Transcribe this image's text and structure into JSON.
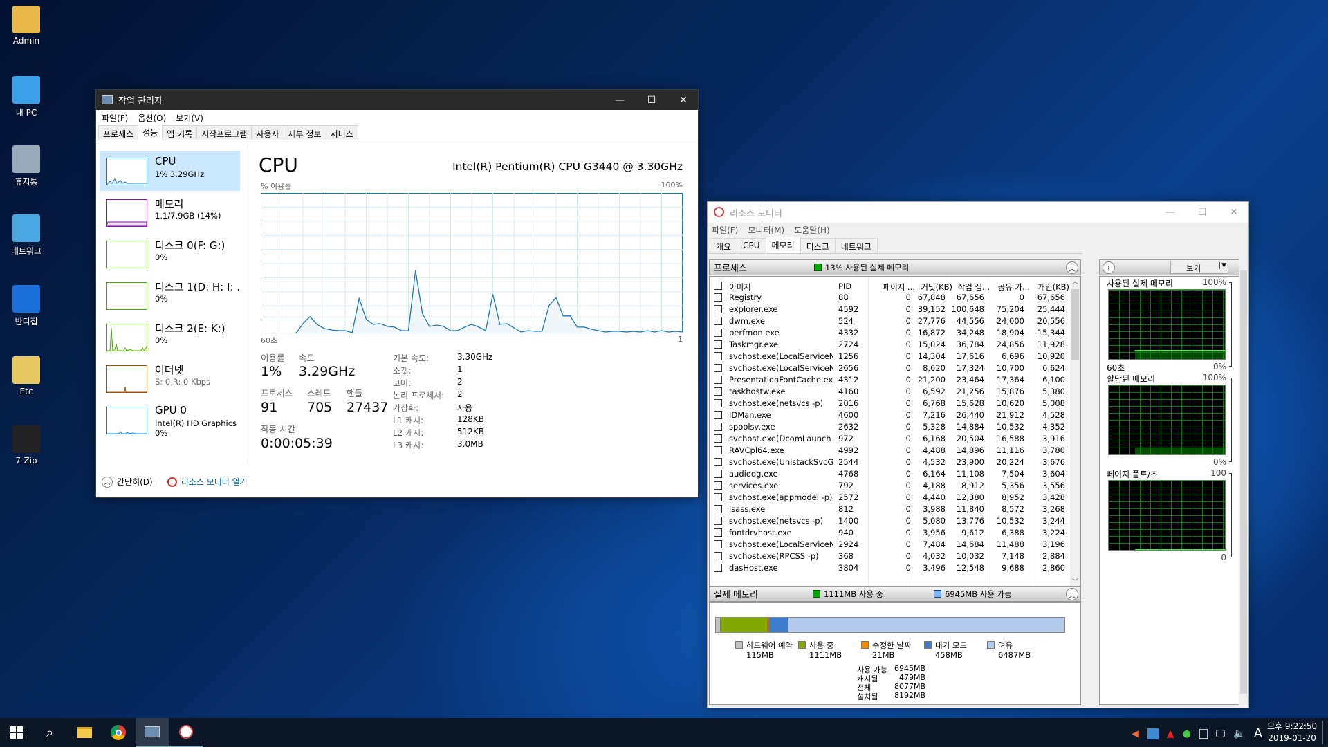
{
  "desktop": {
    "icons": [
      {
        "label": "Admin",
        "icon": "user-folder-icon",
        "color": "#e8b84a"
      },
      {
        "label": "내 PC",
        "icon": "computer-icon",
        "color": "#3aa0e8"
      },
      {
        "label": "휴지통",
        "icon": "recycle-bin-icon",
        "color": "#9ab"
      },
      {
        "label": "네트워크",
        "icon": "network-icon",
        "color": "#4aa6e0"
      },
      {
        "label": "반디집",
        "icon": "bandizip-icon",
        "color": "#1a6fd8"
      },
      {
        "label": "Etc",
        "icon": "folder-icon",
        "color": "#e8c860"
      },
      {
        "label": "7-Zip",
        "icon": "7zip-icon",
        "color": "#222"
      }
    ]
  },
  "task_manager": {
    "title": "작업 관리자",
    "menu": [
      "파일(F)",
      "옵션(O)",
      "보기(V)"
    ],
    "tabs": [
      "프로세스",
      "성능",
      "앱 기록",
      "시작프로그램",
      "사용자",
      "세부 정보",
      "서비스"
    ],
    "active_tab": "성능",
    "sidebar": [
      {
        "name": "CPU",
        "sub": "1% 3.29GHz",
        "color": "#1779ba"
      },
      {
        "name": "메모리",
        "sub": "1.1/7.9GB (14%)",
        "color": "#8b12ae"
      },
      {
        "name": "디스크 0(F: G:)",
        "sub": "0%",
        "color": "#4da60c"
      },
      {
        "name": "디스크 1(D: H: I: .",
        "sub": "0%",
        "color": "#4da60c"
      },
      {
        "name": "디스크 2(E: K:)",
        "sub": "0%",
        "color": "#4da60c"
      },
      {
        "name": "이더넷",
        "sub": "S: 0 R: 0 Kbps",
        "color": "#a74f01"
      },
      {
        "name": "GPU 0",
        "sub": "Intel(R) HD Graphics",
        "sub2": "0%",
        "color": "#1779ba"
      }
    ],
    "cpu": {
      "title": "CPU",
      "model": "Intel(R) Pentium(R) CPU G3440 @ 3.30GHz",
      "y_label": "% 이용률",
      "y_max_label": "100%",
      "x_left_label": "60초",
      "x_right_label": "1",
      "usage_history": [
        0,
        0,
        0,
        0,
        0,
        0,
        7,
        12,
        6.5,
        3.5,
        2.5,
        2,
        2,
        0.5,
        25,
        10,
        6.5,
        7,
        5,
        4.5,
        2,
        2,
        45,
        14,
        5,
        6,
        5,
        2,
        2,
        4.5,
        6.5,
        4.5,
        2,
        28,
        6.5,
        7,
        4,
        1,
        2,
        1.5,
        1.5,
        20,
        25.5,
        12.5,
        12.5,
        4.5,
        4.5,
        3,
        2,
        1,
        1.5,
        1.5,
        1,
        1.5,
        1,
        2,
        1,
        2,
        1,
        1.5,
        1
      ],
      "line_color": "#1779ba",
      "stats": {
        "usage_label": "이용률",
        "usage": "1%",
        "speed_label": "속도",
        "speed": "3.29GHz",
        "processes_label": "프로세스",
        "processes": "91",
        "threads_label": "스레드",
        "threads": "705",
        "handles_label": "핸들",
        "handles": "27437",
        "uptime_label": "작동 시간",
        "uptime": "0:00:05:39"
      },
      "details": [
        [
          "기본 속도:",
          "3.30GHz"
        ],
        [
          "소켓:",
          "1"
        ],
        [
          "코어:",
          "2"
        ],
        [
          "논리 프로세서:",
          "2"
        ],
        [
          "가상화:",
          "사용"
        ],
        [
          "L1 캐시:",
          "128KB"
        ],
        [
          "L2 캐시:",
          "512KB"
        ],
        [
          "L3 캐시:",
          "3.0MB"
        ]
      ]
    },
    "footer": {
      "collapse": "간단히(D)",
      "open_resmon": "리소스 모니터 열기"
    }
  },
  "resource_monitor": {
    "title": "리소스 모니터",
    "menu": [
      "파일(F)",
      "모니터(M)",
      "도움말(H)"
    ],
    "tabs": [
      "개요",
      "CPU",
      "메모리",
      "디스크",
      "네트워크"
    ],
    "active_tab": "메모리",
    "processes": {
      "header": "프로세스",
      "summary": "13% 사용된 실제 메모리",
      "columns": [
        "이미지",
        "PID",
        "페이지 ...",
        "커밋(KB)",
        "작업 집...",
        "공유 가...",
        "개인(KB)"
      ],
      "rows": [
        [
          "Registry",
          "88",
          "0",
          "67,848",
          "67,656",
          "0",
          "67,656"
        ],
        [
          "explorer.exe",
          "4592",
          "0",
          "39,152",
          "100,648",
          "75,204",
          "25,444"
        ],
        [
          "dwm.exe",
          "524",
          "0",
          "27,776",
          "44,556",
          "24,000",
          "20,556"
        ],
        [
          "perfmon.exe",
          "4332",
          "0",
          "16,872",
          "34,248",
          "18,904",
          "15,344"
        ],
        [
          "Taskmgr.exe",
          "2724",
          "0",
          "15,024",
          "36,784",
          "24,856",
          "11,928"
        ],
        [
          "svchost.exe(LocalServiceNetw...",
          "1256",
          "0",
          "14,304",
          "17,616",
          "6,696",
          "10,920"
        ],
        [
          "svchost.exe(LocalServiceNoN...",
          "2656",
          "0",
          "8,620",
          "17,324",
          "10,700",
          "6,624"
        ],
        [
          "PresentationFontCache.exe",
          "4312",
          "0",
          "21,200",
          "23,464",
          "17,364",
          "6,100"
        ],
        [
          "taskhostw.exe",
          "4160",
          "0",
          "6,592",
          "21,256",
          "15,876",
          "5,380"
        ],
        [
          "svchost.exe(netsvcs -p)",
          "2016",
          "0",
          "6,768",
          "15,628",
          "10,620",
          "5,008"
        ],
        [
          "IDMan.exe",
          "4600",
          "0",
          "7,216",
          "26,440",
          "21,912",
          "4,528"
        ],
        [
          "spoolsv.exe",
          "2632",
          "0",
          "5,328",
          "14,884",
          "10,532",
          "4,352"
        ],
        [
          "svchost.exe(DcomLaunch -p)",
          "972",
          "0",
          "6,168",
          "20,504",
          "16,588",
          "3,916"
        ],
        [
          "RAVCpl64.exe",
          "4992",
          "0",
          "4,488",
          "14,896",
          "11,116",
          "3,780"
        ],
        [
          "svchost.exe(UnistackSvcGroup)",
          "2544",
          "0",
          "4,532",
          "23,900",
          "20,224",
          "3,676"
        ],
        [
          "audiodg.exe",
          "4768",
          "0",
          "6,164",
          "11,108",
          "7,504",
          "3,604"
        ],
        [
          "services.exe",
          "792",
          "0",
          "4,188",
          "8,912",
          "5,356",
          "3,556"
        ],
        [
          "svchost.exe(appmodel -p)",
          "2572",
          "0",
          "4,440",
          "12,380",
          "8,952",
          "3,428"
        ],
        [
          "lsass.exe",
          "812",
          "0",
          "3,988",
          "11,840",
          "8,572",
          "3,268"
        ],
        [
          "svchost.exe(netsvcs -p)",
          "1400",
          "0",
          "5,080",
          "13,776",
          "10,532",
          "3,244"
        ],
        [
          "fontdrvhost.exe",
          "940",
          "0",
          "3,956",
          "9,612",
          "6,388",
          "3,224"
        ],
        [
          "svchost.exe(LocalServiceNoN...",
          "2924",
          "0",
          "7,484",
          "14,684",
          "11,488",
          "3,196"
        ],
        [
          "svchost.exe(RPCSS -p)",
          "368",
          "0",
          "4,032",
          "10,032",
          "7,148",
          "2,884"
        ],
        [
          "dasHost.exe",
          "3804",
          "0",
          "3,496",
          "12,548",
          "9,688",
          "2,860"
        ]
      ]
    },
    "physical_memory": {
      "header": "실제 메모리",
      "in_use_summary": "1111MB 사용 중",
      "available_summary": "6945MB 사용 가능",
      "legend": [
        {
          "label": "하드웨어 예약",
          "value": "115MB",
          "mb": 115,
          "color": "#c0c0c0"
        },
        {
          "label": "사용 중",
          "value": "1111MB",
          "mb": 1111,
          "color": "#82a800"
        },
        {
          "label": "수정한 날짜",
          "value": "21MB",
          "mb": 21,
          "color": "#f08c00"
        },
        {
          "label": "대기 모드",
          "value": "458MB",
          "mb": 458,
          "color": "#3c7ccc"
        },
        {
          "label": "여유",
          "value": "6487MB",
          "mb": 6487,
          "color": "#b4ccec"
        }
      ],
      "totals": [
        [
          "사용 가능",
          "6945MB"
        ],
        [
          "캐시됨",
          "479MB"
        ],
        [
          "전체",
          "8077MB"
        ],
        [
          "설치됨",
          "8192MB"
        ]
      ]
    },
    "graphs_panel": {
      "view_button": "보기",
      "graphs": [
        {
          "title": "사용된 실제 메모리",
          "max": "100%",
          "min": "0%",
          "time": "60초",
          "level_percent": 13
        },
        {
          "title": "할당된 메모리",
          "max": "100%",
          "min": "0%",
          "level_percent": 10
        },
        {
          "title": "페이지 폴트/초",
          "max": "100",
          "min": "0",
          "level_percent": 1
        }
      ]
    }
  },
  "taskbar": {
    "clock_time": "오후 9:22:50",
    "clock_date": "2019-01-20",
    "ime": "A"
  }
}
